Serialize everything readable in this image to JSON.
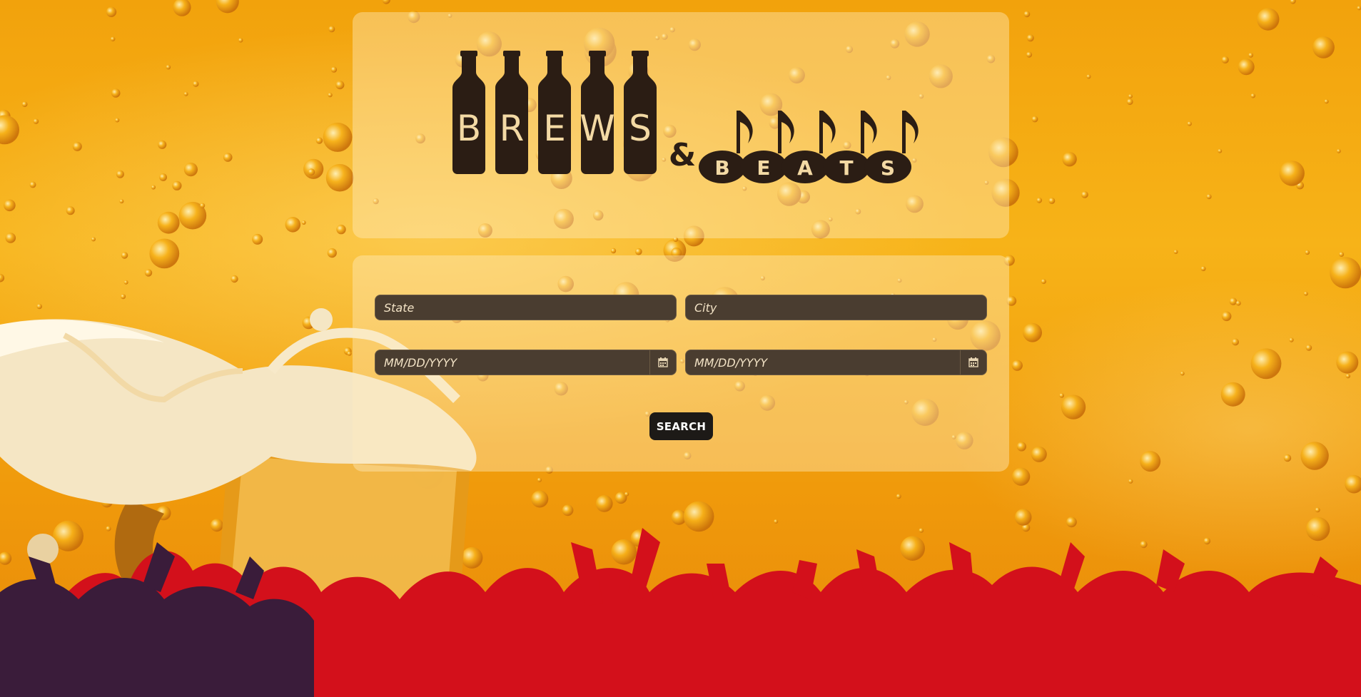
{
  "logo": {
    "brews": "BREWS",
    "ampersand": "&",
    "beats": [
      "B",
      "E",
      "A",
      "T",
      "S"
    ]
  },
  "form": {
    "state_placeholder": "State",
    "city_placeholder": "City",
    "start_date_placeholder": "MM/DD/YYYY",
    "end_date_placeholder": "MM/DD/YYYY",
    "search_label": "SEARCH"
  },
  "icons": {
    "calendar": "calendar-icon"
  },
  "colors": {
    "beer": "#f2a20c",
    "crowd": "#d3101b",
    "button": "#1d1a17",
    "field": "#4a3d30"
  }
}
